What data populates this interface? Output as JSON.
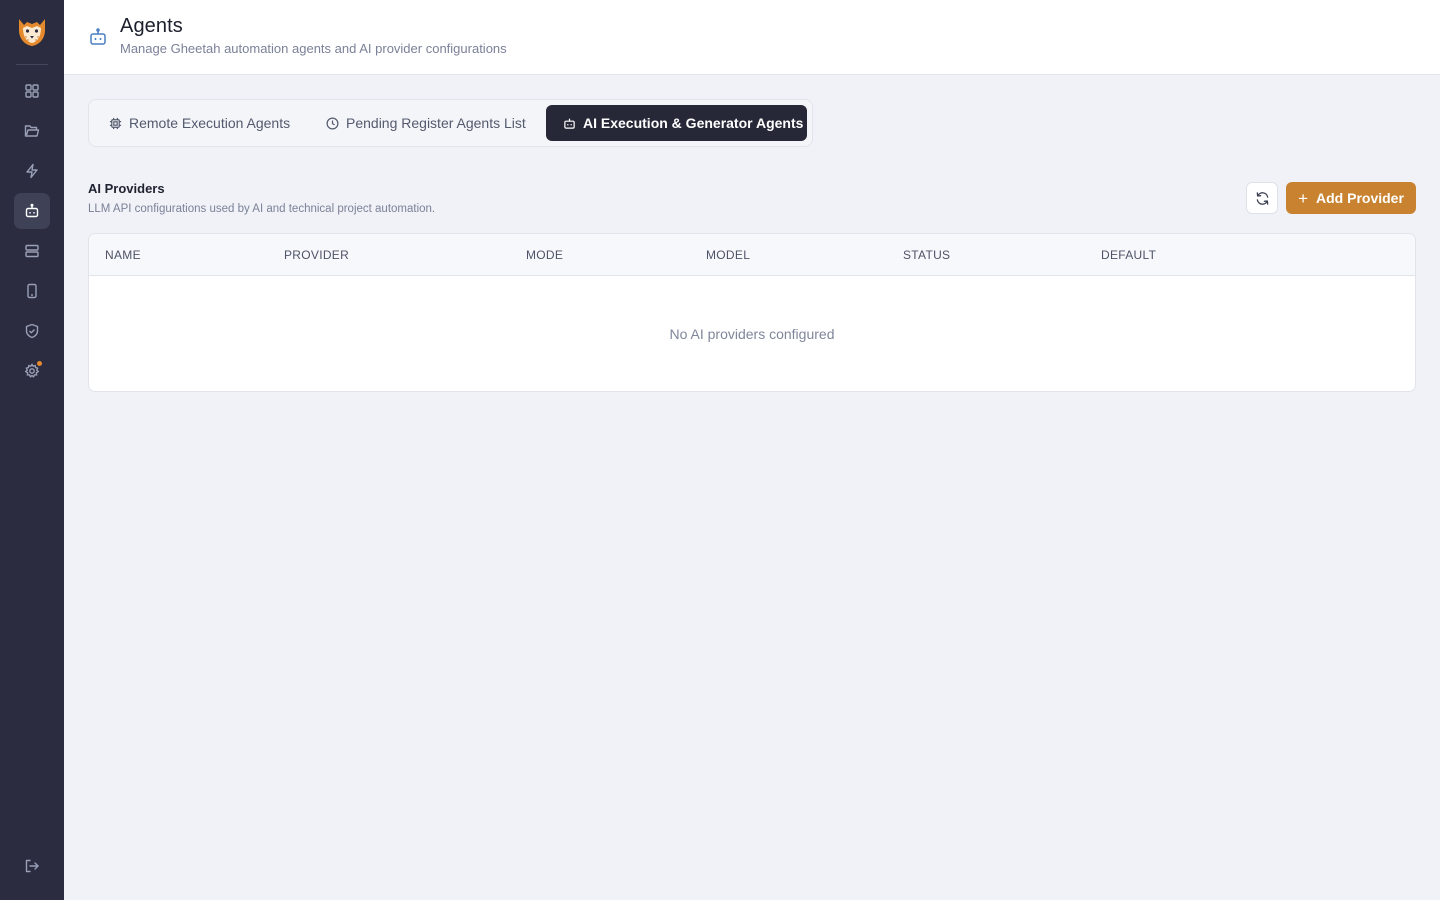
{
  "header": {
    "title": "Agents",
    "subtitle": "Manage Gheetah automation agents and AI provider configurations"
  },
  "sidebar": {
    "items": [
      {
        "icon": "dashboard-icon"
      },
      {
        "icon": "folder-icon"
      },
      {
        "icon": "lightning-icon"
      },
      {
        "icon": "robot-icon",
        "active": true
      },
      {
        "icon": "server-icon"
      },
      {
        "icon": "mobile-icon"
      },
      {
        "icon": "shield-icon"
      },
      {
        "icon": "gear-icon",
        "notification": true
      },
      {
        "icon": "logout-icon"
      }
    ]
  },
  "tabs": [
    {
      "label": "Remote Execution Agents",
      "icon": "chip-icon"
    },
    {
      "label": "Pending Register Agents List",
      "icon": "clock-icon"
    },
    {
      "label": "AI Execution & Generator Agents",
      "icon": "robot-icon",
      "active": true
    }
  ],
  "section": {
    "title": "AI Providers",
    "subtitle": "LLM API configurations used by AI and technical project automation."
  },
  "actions": {
    "add_label": "Add Provider"
  },
  "table": {
    "columns": [
      "NAME",
      "PROVIDER",
      "MODE",
      "MODEL",
      "STATUS",
      "DEFAULT"
    ],
    "rows": [],
    "empty_message": "No AI providers configured"
  },
  "colors": {
    "sidebar_bg": "#2b2c40",
    "accent": "#c98330",
    "active_tab_bg": "#262838",
    "page_bg": "#f1f2f7"
  }
}
